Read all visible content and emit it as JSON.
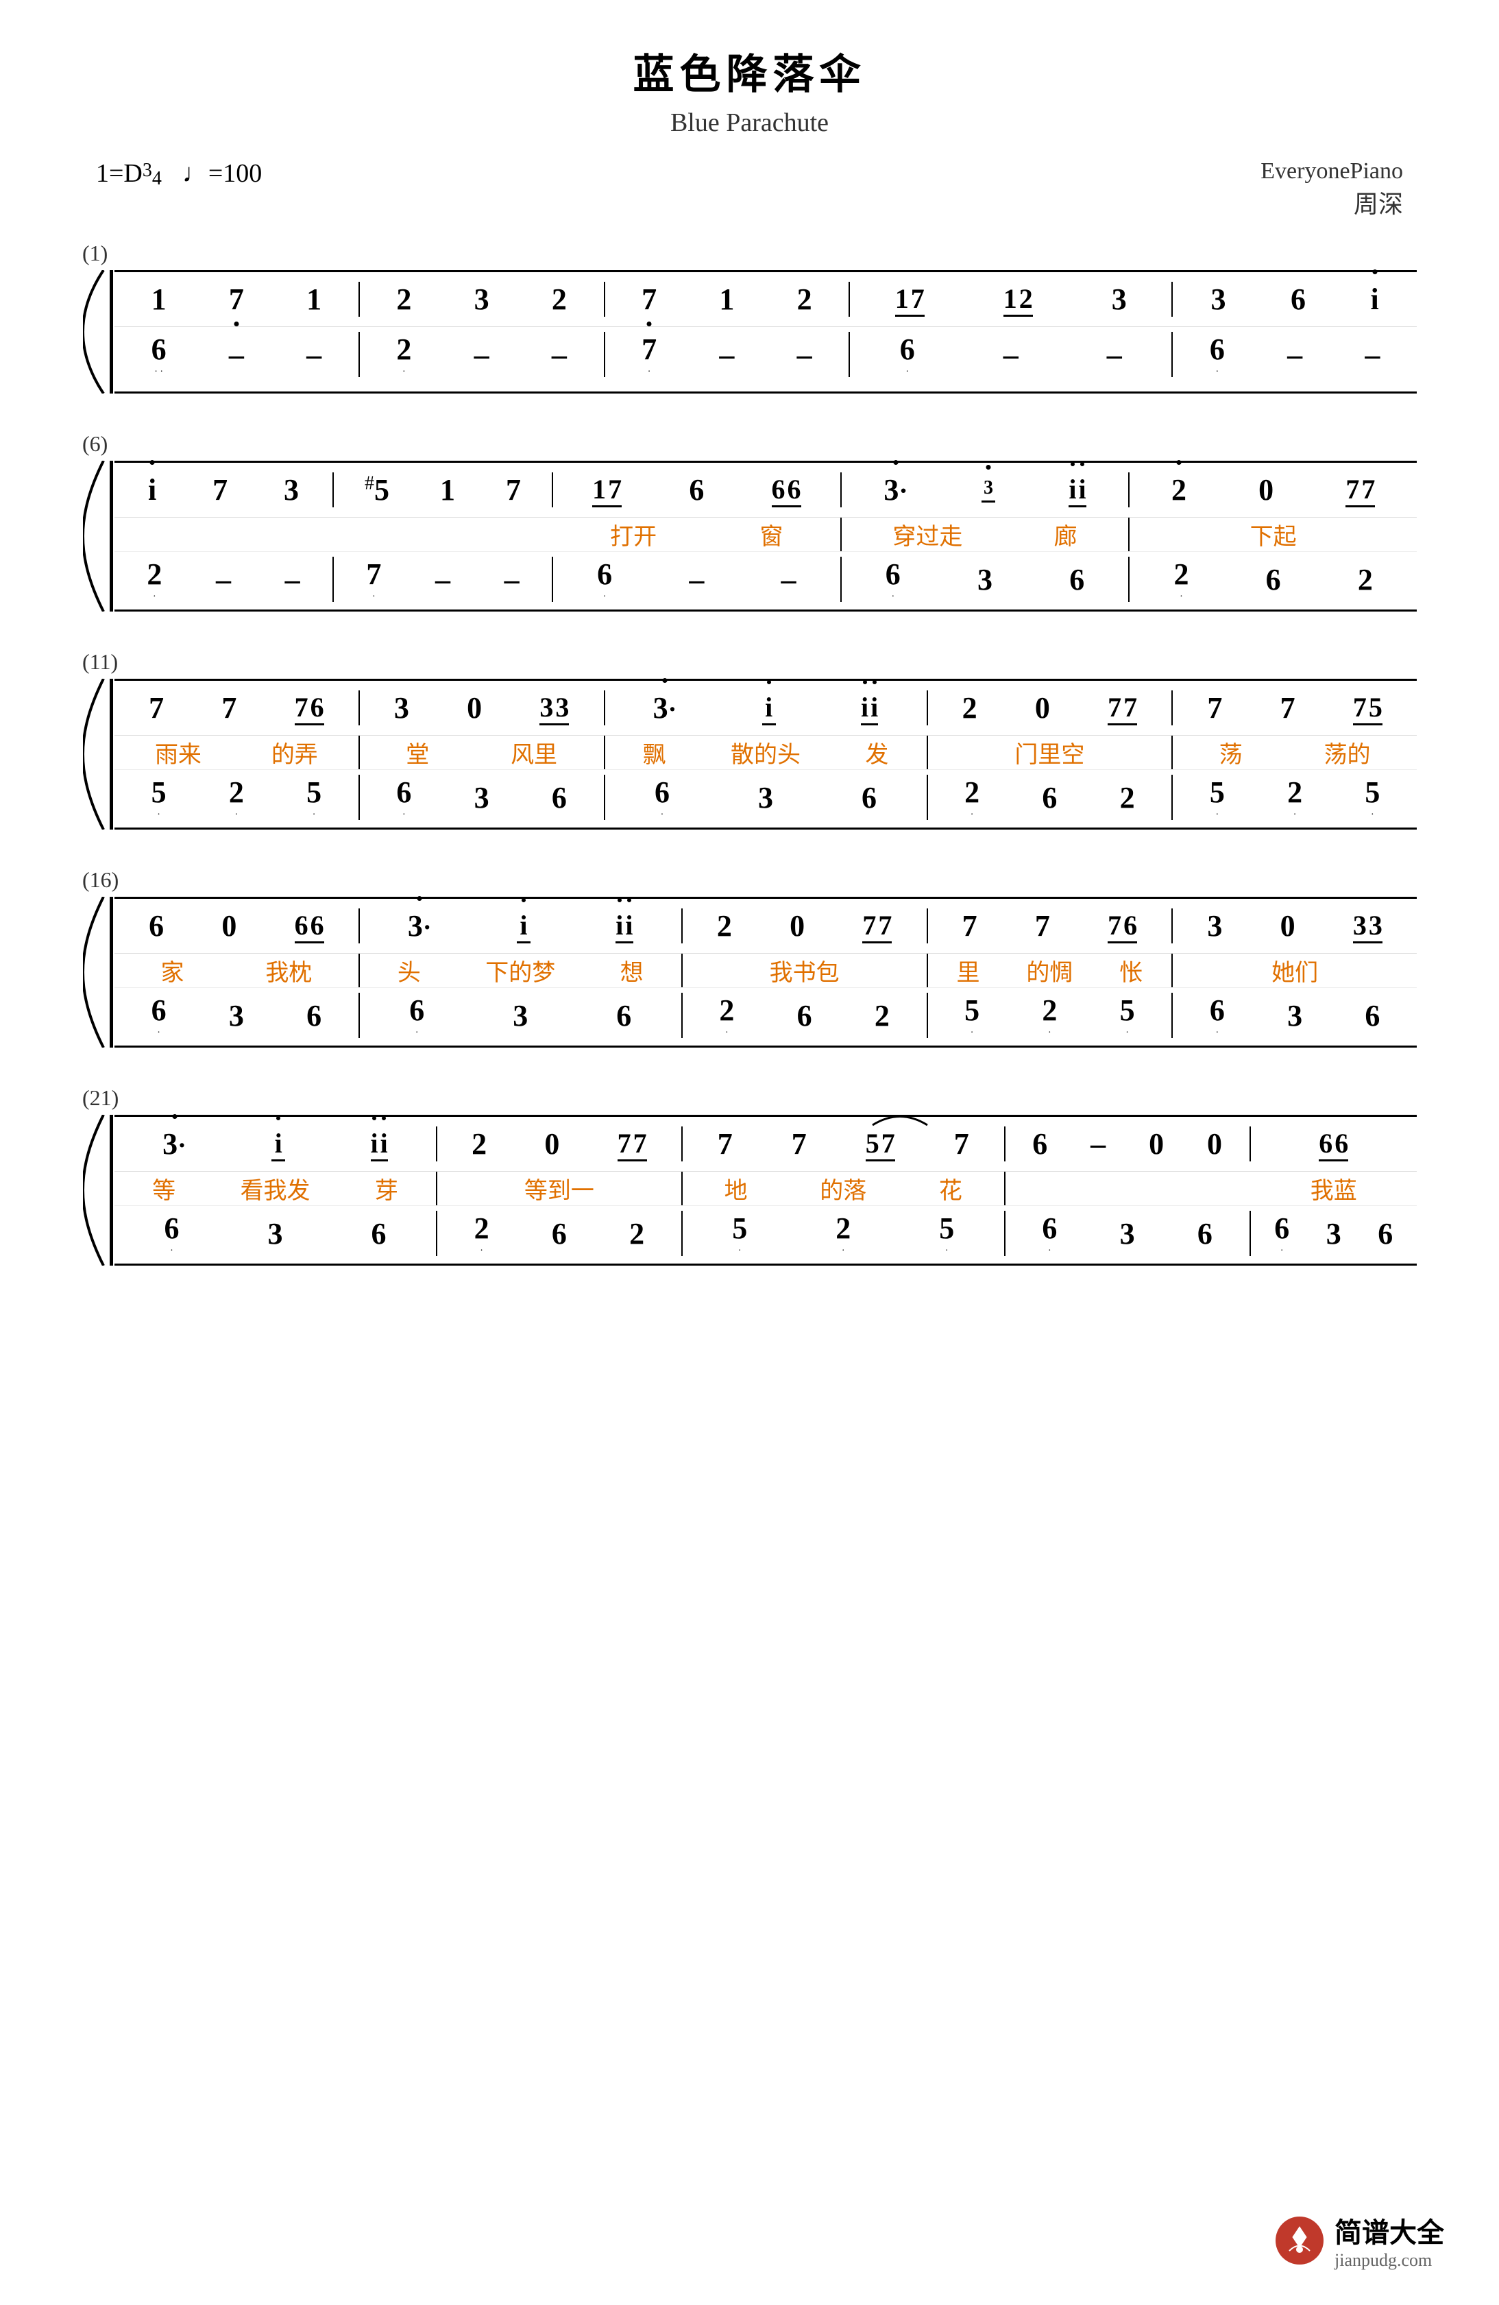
{
  "title": {
    "chinese": "蓝色降落伞",
    "english": "Blue Parachute",
    "key": "1=D",
    "time_sig": "3/4",
    "tempo": "♩=100",
    "source": "EveryonePiano",
    "composer": "周深"
  },
  "systems": [
    {
      "number": "(1)",
      "treble": [
        {
          "notes": [
            "1",
            "7̣",
            "1"
          ],
          "bar": true
        },
        {
          "notes": [
            "2",
            "3",
            "2"
          ],
          "bar": true
        },
        {
          "notes": [
            "7̣",
            "1",
            "2"
          ],
          "bar": true
        },
        {
          "notes": [
            "1̲7̲",
            "1̲2̲",
            "3"
          ],
          "bar": true
        },
        {
          "notes": [
            "3",
            "6",
            "i̇"
          ],
          "bar": true
        }
      ],
      "bass": [
        {
          "notes": [
            "6̣",
            "–",
            "–"
          ],
          "bar": true
        },
        {
          "notes": [
            "2̣",
            "–",
            "–"
          ],
          "bar": true
        },
        {
          "notes": [
            "7̣",
            "–",
            "–"
          ],
          "bar": true
        },
        {
          "notes": [
            "6̣",
            "–",
            "–"
          ],
          "bar": true
        },
        {
          "notes": [
            "6̣",
            "–",
            "–"
          ],
          "bar": true
        }
      ]
    },
    {
      "number": "(6)",
      "treble": [
        {
          "notes": [
            "i̇",
            "7",
            "3"
          ],
          "bar": true
        },
        {
          "notes": [
            "#5",
            "1",
            "7"
          ],
          "bar": true
        },
        {
          "notes": [
            "1̲7̲",
            "6",
            "6̲6̲"
          ],
          "bar": true
        },
        {
          "notes": [
            "3̇·",
            "3̲",
            "i̲i̲"
          ],
          "bar": true
        },
        {
          "notes": [
            "2̇",
            "0",
            "7̲7̲"
          ],
          "bar": true
        }
      ],
      "lyrics": [
        "打开",
        "窗",
        "穿过走",
        "廊",
        "下起"
      ],
      "bass": [
        {
          "notes": [
            "2̣",
            "–",
            "–"
          ],
          "bar": true
        },
        {
          "notes": [
            "7̣",
            "–",
            "–"
          ],
          "bar": true
        },
        {
          "notes": [
            "6̣",
            "–",
            "–"
          ],
          "bar": true
        },
        {
          "notes": [
            "6̣",
            "3",
            "6"
          ],
          "bar": true
        },
        {
          "notes": [
            "2̣",
            "6",
            "2"
          ],
          "bar": true
        }
      ]
    },
    {
      "number": "(11)",
      "treble": [
        {
          "notes": [
            "7",
            "7",
            "7̲6̲"
          ],
          "bar": true
        },
        {
          "notes": [
            "3",
            "0",
            "3̲3̲"
          ],
          "bar": true
        },
        {
          "notes": [
            "3̇·",
            "i̲",
            "i̲i̲"
          ],
          "bar": true
        },
        {
          "notes": [
            "2",
            "0",
            "7̲7̲"
          ],
          "bar": true
        },
        {
          "notes": [
            "7",
            "7",
            "7̲5̲"
          ],
          "bar": true
        }
      ],
      "lyrics": [
        "雨来",
        "的弄",
        "堂",
        "风里",
        "飘",
        "散的头",
        "发",
        "门里空",
        "荡",
        "荡的"
      ],
      "bass": [
        {
          "notes": [
            "5̣",
            "2̣",
            "5̣"
          ],
          "bar": true
        },
        {
          "notes": [
            "6̣",
            "3",
            "6"
          ],
          "bar": true
        },
        {
          "notes": [
            "6̣",
            "3",
            "6"
          ],
          "bar": true
        },
        {
          "notes": [
            "2̣",
            "6",
            "2"
          ],
          "bar": true
        },
        {
          "notes": [
            "5̣",
            "2̣",
            "5̣"
          ],
          "bar": true
        }
      ]
    },
    {
      "number": "(16)",
      "treble": [
        {
          "notes": [
            "6",
            "0",
            "6̲6̲"
          ],
          "bar": true
        },
        {
          "notes": [
            "3̇·",
            "i̲",
            "i̲i̲"
          ],
          "bar": true
        },
        {
          "notes": [
            "2",
            "0",
            "7̲7̲"
          ],
          "bar": true
        },
        {
          "notes": [
            "7",
            "7",
            "7̲6̲"
          ],
          "bar": true
        },
        {
          "notes": [
            "3",
            "0",
            "3̲3̲"
          ],
          "bar": true
        }
      ],
      "lyrics": [
        "家",
        "我枕",
        "头",
        "下的梦",
        "想",
        "我书包",
        "里",
        "的惆",
        "怅",
        "她们"
      ],
      "bass": [
        {
          "notes": [
            "6̣",
            "3",
            "6"
          ],
          "bar": true
        },
        {
          "notes": [
            "6̣",
            "3",
            "6"
          ],
          "bar": true
        },
        {
          "notes": [
            "2̣",
            "6",
            "2"
          ],
          "bar": true
        },
        {
          "notes": [
            "5̣",
            "2̣",
            "5̣"
          ],
          "bar": true
        },
        {
          "notes": [
            "6̣",
            "3",
            "6"
          ],
          "bar": true
        }
      ]
    },
    {
      "number": "(21)",
      "treble": [
        {
          "notes": [
            "3̇·",
            "i̲",
            "i̲i̲"
          ],
          "bar": true
        },
        {
          "notes": [
            "2",
            "0",
            "7̲7̲"
          ],
          "bar": true
        },
        {
          "notes": [
            "7",
            "7",
            "5̲7̲~7"
          ],
          "bar": true
        },
        {
          "notes": [
            "6",
            "–",
            "0 0"
          ],
          "bar": true
        },
        {
          "notes": [
            "6̲6̲"
          ],
          "bar": true
        }
      ],
      "lyrics": [
        "等",
        "看我发",
        "芽",
        "等到一",
        "地",
        "的落",
        "花",
        "",
        "我蓝"
      ],
      "bass": [
        {
          "notes": [
            "6̣",
            "3",
            "6"
          ],
          "bar": true
        },
        {
          "notes": [
            "2̣",
            "6",
            "2"
          ],
          "bar": true
        },
        {
          "notes": [
            "5̣",
            "2̣",
            "5̣"
          ],
          "bar": true
        },
        {
          "notes": [
            "6̣",
            "3",
            "6"
          ],
          "bar": true
        },
        {
          "notes": [
            "6̣",
            "3",
            "6"
          ],
          "bar": true
        }
      ]
    }
  ],
  "watermark": {
    "site": "jianpudg.com",
    "label": "简谱大全"
  }
}
